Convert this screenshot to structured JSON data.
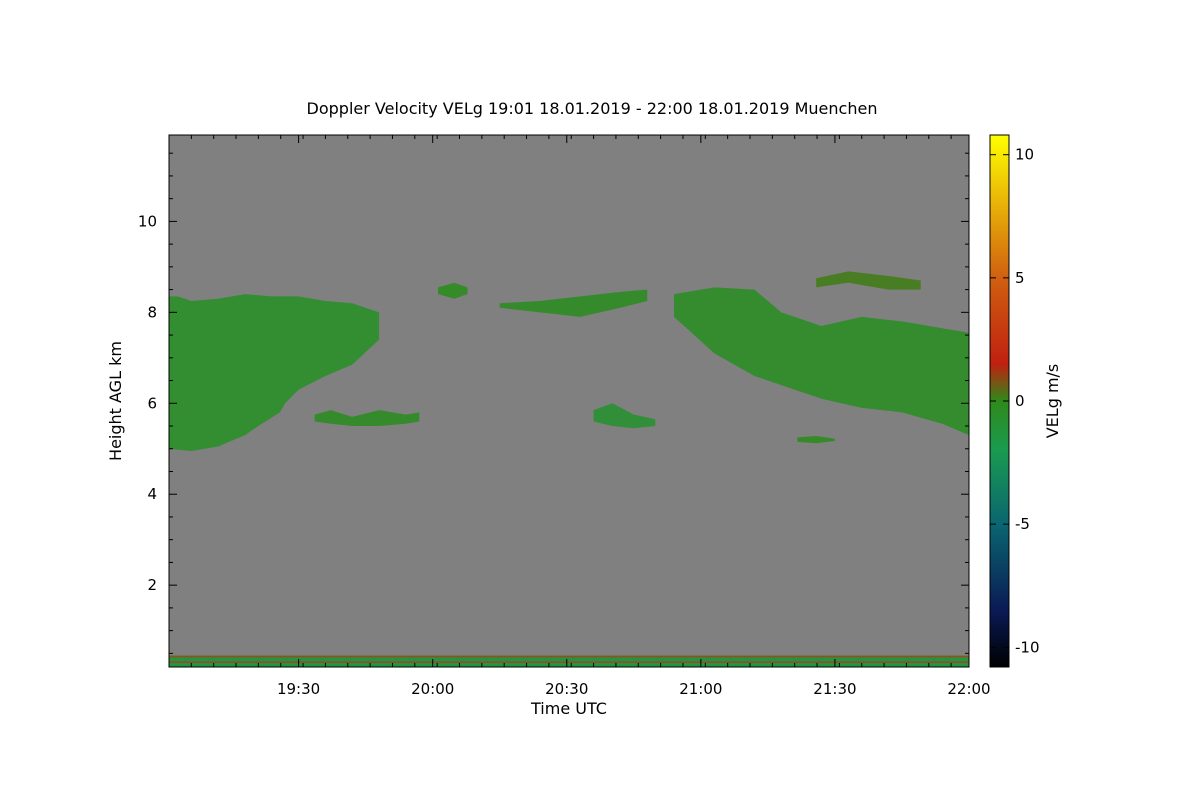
{
  "chart_data": {
    "type": "heatmap",
    "title": "Doppler Velocity VELg   19:01 18.01.2019 - 22:00 18.01.2019 Muenchen",
    "xlabel": "Time UTC",
    "ylabel": "Height AGL km",
    "colorbar_label": "VELg m/s",
    "x_ticks": [
      {
        "value": 19.5,
        "label": "19:30"
      },
      {
        "value": 20.0,
        "label": "20:00"
      },
      {
        "value": 20.5,
        "label": "20:30"
      },
      {
        "value": 21.0,
        "label": "21:00"
      },
      {
        "value": 21.5,
        "label": "21:30"
      },
      {
        "value": 22.0,
        "label": "22:00"
      }
    ],
    "y_ticks": [
      {
        "value": 2,
        "label": "2"
      },
      {
        "value": 4,
        "label": "4"
      },
      {
        "value": 6,
        "label": "6"
      },
      {
        "value": 8,
        "label": "8"
      },
      {
        "value": 10,
        "label": "10"
      }
    ],
    "colorbar_ticks": [
      {
        "value": 10,
        "label": "10"
      },
      {
        "value": 5,
        "label": "5"
      },
      {
        "value": 0,
        "label": "0"
      },
      {
        "value": -5,
        "label": "-5"
      },
      {
        "value": -10,
        "label": "-10"
      }
    ],
    "xlim": [
      19.0167,
      22.0
    ],
    "ylim": [
      0.2,
      11.9
    ],
    "clim": [
      -10.8,
      10.8
    ],
    "colormap": [
      {
        "value": -10.8,
        "color": "#000000"
      },
      {
        "value": -8.5,
        "color": "#0a1a55"
      },
      {
        "value": -5.0,
        "color": "#0a6670"
      },
      {
        "value": -2.0,
        "color": "#1a9a50"
      },
      {
        "value": 0.0,
        "color": "#2f8a1a"
      },
      {
        "value": 1.5,
        "color": "#c02010"
      },
      {
        "value": 5.0,
        "color": "#d06010"
      },
      {
        "value": 10.8,
        "color": "#ffff00"
      }
    ],
    "background_color": "#808080",
    "cloud_regions": [
      {
        "name": "cloud-left-main",
        "velocity": -0.5,
        "top": [
          [
            19.0167,
            8.35
          ],
          [
            19.05,
            8.35
          ],
          [
            19.1,
            8.25
          ],
          [
            19.2,
            8.3
          ],
          [
            19.3,
            8.4
          ],
          [
            19.4,
            8.35
          ],
          [
            19.5,
            8.35
          ],
          [
            19.6,
            8.25
          ],
          [
            19.7,
            8.2
          ],
          [
            19.8,
            8.0
          ]
        ],
        "bottom": [
          [
            19.0167,
            5.0
          ],
          [
            19.1,
            4.95
          ],
          [
            19.2,
            5.05
          ],
          [
            19.3,
            5.3
          ],
          [
            19.35,
            5.5
          ],
          [
            19.43,
            5.8
          ],
          [
            19.45,
            6.0
          ],
          [
            19.5,
            6.3
          ],
          [
            19.6,
            6.6
          ],
          [
            19.7,
            6.85
          ],
          [
            19.8,
            7.4
          ]
        ]
      },
      {
        "name": "cloud-2016-top-left",
        "velocity": -0.2,
        "top": [
          [
            20.02,
            8.55
          ],
          [
            20.08,
            8.65
          ],
          [
            20.13,
            8.55
          ]
        ],
        "bottom": [
          [
            20.02,
            8.4
          ],
          [
            20.08,
            8.3
          ],
          [
            20.13,
            8.4
          ]
        ]
      },
      {
        "name": "cloud-mid-band",
        "velocity": -0.3,
        "top": [
          [
            20.25,
            8.2
          ],
          [
            20.4,
            8.25
          ],
          [
            20.55,
            8.35
          ],
          [
            20.7,
            8.45
          ],
          [
            20.8,
            8.5
          ]
        ],
        "bottom": [
          [
            20.25,
            8.1
          ],
          [
            20.4,
            8.0
          ],
          [
            20.55,
            7.9
          ],
          [
            20.7,
            8.1
          ],
          [
            20.8,
            8.25
          ]
        ]
      },
      {
        "name": "cloud-center-right",
        "velocity": -0.4,
        "top": [
          [
            20.9,
            8.4
          ],
          [
            21.05,
            8.55
          ],
          [
            21.2,
            8.5
          ],
          [
            21.3,
            8.0
          ],
          [
            21.45,
            7.7
          ],
          [
            21.6,
            7.9
          ],
          [
            21.75,
            7.8
          ],
          [
            21.9,
            7.65
          ],
          [
            22.0,
            7.55
          ]
        ],
        "bottom": [
          [
            20.9,
            7.9
          ],
          [
            21.05,
            7.1
          ],
          [
            21.2,
            6.6
          ],
          [
            21.3,
            6.4
          ],
          [
            21.45,
            6.1
          ],
          [
            21.6,
            5.9
          ],
          [
            21.75,
            5.8
          ],
          [
            21.9,
            5.55
          ],
          [
            22.0,
            5.3
          ]
        ]
      },
      {
        "name": "cloud-upper-right",
        "velocity": 0.2,
        "top": [
          [
            21.43,
            8.75
          ],
          [
            21.55,
            8.9
          ],
          [
            21.7,
            8.8
          ],
          [
            21.82,
            8.7
          ]
        ],
        "bottom": [
          [
            21.43,
            8.55
          ],
          [
            21.55,
            8.65
          ],
          [
            21.7,
            8.5
          ],
          [
            21.82,
            8.5
          ]
        ]
      },
      {
        "name": "cloud-lens-2045",
        "velocity": -0.8,
        "top": [
          [
            20.6,
            5.85
          ],
          [
            20.67,
            6.0
          ],
          [
            20.75,
            5.75
          ],
          [
            20.83,
            5.65
          ]
        ],
        "bottom": [
          [
            20.6,
            5.6
          ],
          [
            20.67,
            5.5
          ],
          [
            20.75,
            5.45
          ],
          [
            20.83,
            5.5
          ]
        ]
      },
      {
        "name": "cloud-small-2130",
        "velocity": -0.1,
        "top": [
          [
            21.36,
            5.25
          ],
          [
            21.43,
            5.28
          ],
          [
            21.5,
            5.22
          ]
        ],
        "bottom": [
          [
            21.36,
            5.15
          ],
          [
            21.43,
            5.12
          ],
          [
            21.5,
            5.17
          ]
        ]
      },
      {
        "name": "cloud-specks-1945",
        "velocity": -0.3,
        "top": [
          [
            19.56,
            5.75
          ],
          [
            19.62,
            5.85
          ],
          [
            19.7,
            5.7
          ],
          [
            19.8,
            5.85
          ],
          [
            19.9,
            5.75
          ],
          [
            19.95,
            5.8
          ]
        ],
        "bottom": [
          [
            19.56,
            5.6
          ],
          [
            19.62,
            5.55
          ],
          [
            19.7,
            5.5
          ],
          [
            19.8,
            5.5
          ],
          [
            19.9,
            5.55
          ],
          [
            19.95,
            5.6
          ]
        ]
      }
    ],
    "ground_clutter": {
      "from": 0.2,
      "to": 0.45
    }
  }
}
